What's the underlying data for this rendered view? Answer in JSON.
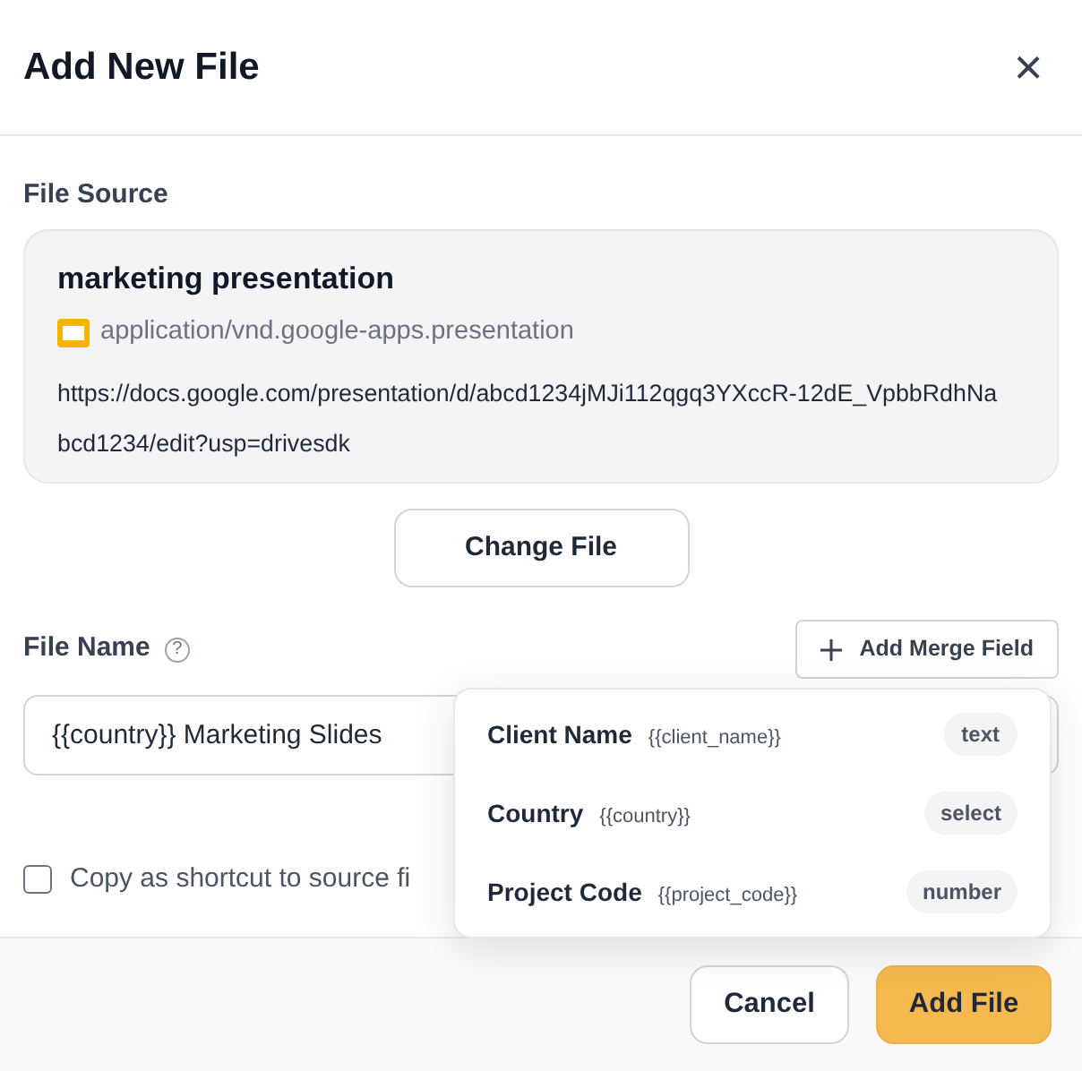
{
  "dialog": {
    "title": "Add New File",
    "close_icon": "×"
  },
  "file_source": {
    "label": "File Source",
    "name": "marketing presentation",
    "mime_type": "application/vnd.google-apps.presentation",
    "url": "https://docs.google.com/presentation/d/abcd1234jMJi112qgq3YXccR-12dE_VpbbRdhNabcd1234/edit?usp=drivesdk",
    "change_button": "Change File"
  },
  "file_name": {
    "label": "File Name",
    "help_icon": "?",
    "merge_button": "Add Merge Field",
    "value": "{{country}} Marketing Slides"
  },
  "merge_fields": [
    {
      "name": "Client Name",
      "token": "{{client_name}}",
      "type": "text"
    },
    {
      "name": "Country",
      "token": "{{country}}",
      "type": "select"
    },
    {
      "name": "Project Code",
      "token": "{{project_code}}",
      "type": "number"
    }
  ],
  "shortcut": {
    "label": "Copy as shortcut to source fi",
    "checked": false
  },
  "buttons": [
    {
      "label": "Cancel",
      "kind": "secondary"
    },
    {
      "label": "Add File",
      "kind": "primary"
    }
  ]
}
